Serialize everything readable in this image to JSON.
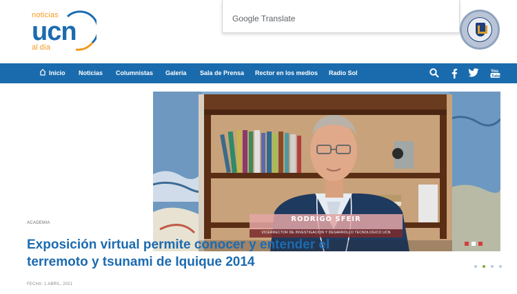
{
  "logo": {
    "noticias": "noticias",
    "brand": "ucn",
    "tagline": "al día"
  },
  "translate_widget": {
    "label": "Google Translate"
  },
  "seal": {
    "name": "UNIVERSIDAD CATÓLICA DEL NORTE CHILE"
  },
  "nav": {
    "items": [
      {
        "label": "Inicio"
      },
      {
        "label": "Noticias"
      },
      {
        "label": "Columnistas"
      },
      {
        "label": "Galería"
      },
      {
        "label": "Sala de Prensa"
      },
      {
        "label": "Rector en los medios"
      },
      {
        "label": "Radio Sol"
      }
    ],
    "icons": [
      "search-icon",
      "facebook-icon",
      "twitter-icon",
      "youtube-icon"
    ]
  },
  "hero": {
    "caption_name": "RODRIGO SFEIR",
    "caption_role": "VICERRECTOR DE INVESTIGACIÓN Y DESARROLLO TECNOLÓGICO UCN"
  },
  "slider": {
    "count": 4,
    "active_index": 1
  },
  "article": {
    "category": "ACADEMIA",
    "headline": "Exposición virtual permite conocer y entender el terremoto y tsunami de Iquique 2014",
    "date": "FECHA: 1 ABRIL, 2021"
  },
  "colors": {
    "brand_blue": "#1a6bad",
    "accent_orange": "#f39a1e",
    "headline_blue": "#1c6bb0"
  }
}
